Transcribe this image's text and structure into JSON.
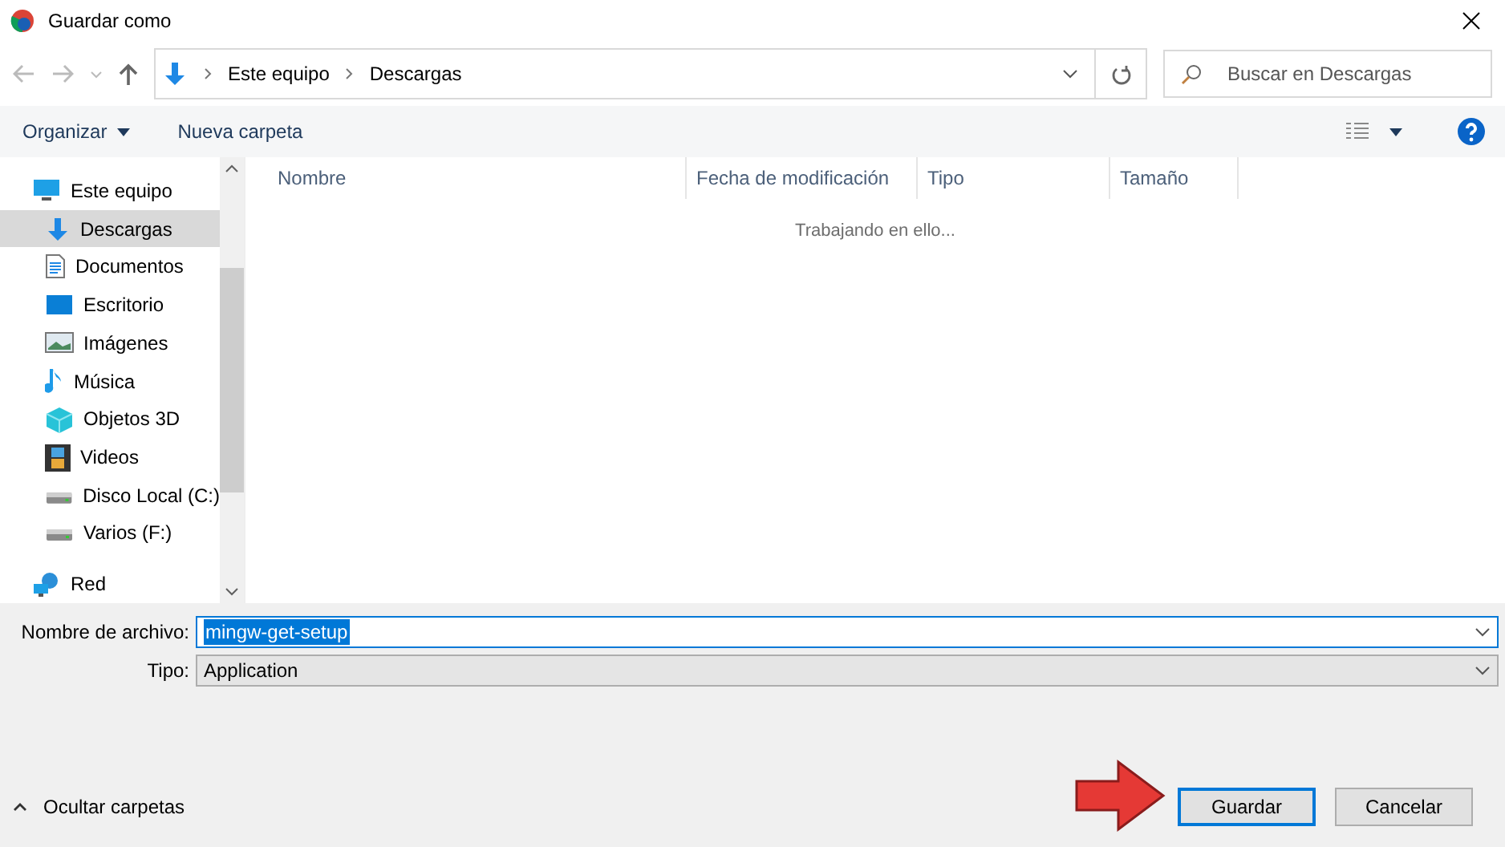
{
  "window": {
    "title": "Guardar como"
  },
  "address": {
    "path": [
      "Este equipo",
      "Descargas"
    ]
  },
  "search": {
    "placeholder": "Buscar en Descargas"
  },
  "toolbar": {
    "organize": "Organizar",
    "new_folder": "Nueva carpeta"
  },
  "sidebar": {
    "items": [
      {
        "label": "Este equipo",
        "kind": "computer",
        "selected": false,
        "children": [
          {
            "label": "Descargas",
            "kind": "download",
            "selected": true
          },
          {
            "label": "Documentos",
            "kind": "document",
            "selected": false
          },
          {
            "label": "Escritorio",
            "kind": "desktop",
            "selected": false
          },
          {
            "label": "Imágenes",
            "kind": "images",
            "selected": false
          },
          {
            "label": "Música",
            "kind": "music",
            "selected": false
          },
          {
            "label": "Objetos 3D",
            "kind": "cube",
            "selected": false
          },
          {
            "label": "Videos",
            "kind": "film",
            "selected": false
          },
          {
            "label": "Disco Local (C:)",
            "kind": "drive",
            "selected": false
          },
          {
            "label": "Varios (F:)",
            "kind": "drive",
            "selected": false
          }
        ]
      },
      {
        "label": "Red",
        "kind": "network",
        "selected": false
      }
    ]
  },
  "table": {
    "columns": [
      "Nombre",
      "Fecha de modificación",
      "Tipo",
      "Tamaño"
    ],
    "status": "Trabajando en ello..."
  },
  "form": {
    "filename_label": "Nombre de archivo:",
    "filename": "mingw-get-setup",
    "type_label": "Tipo:",
    "type": "Application"
  },
  "footer": {
    "toggle": "Ocultar carpetas",
    "buttons": [
      {
        "label": "Guardar",
        "kind": "primary"
      },
      {
        "label": "Cancelar",
        "kind": "normal"
      }
    ]
  }
}
